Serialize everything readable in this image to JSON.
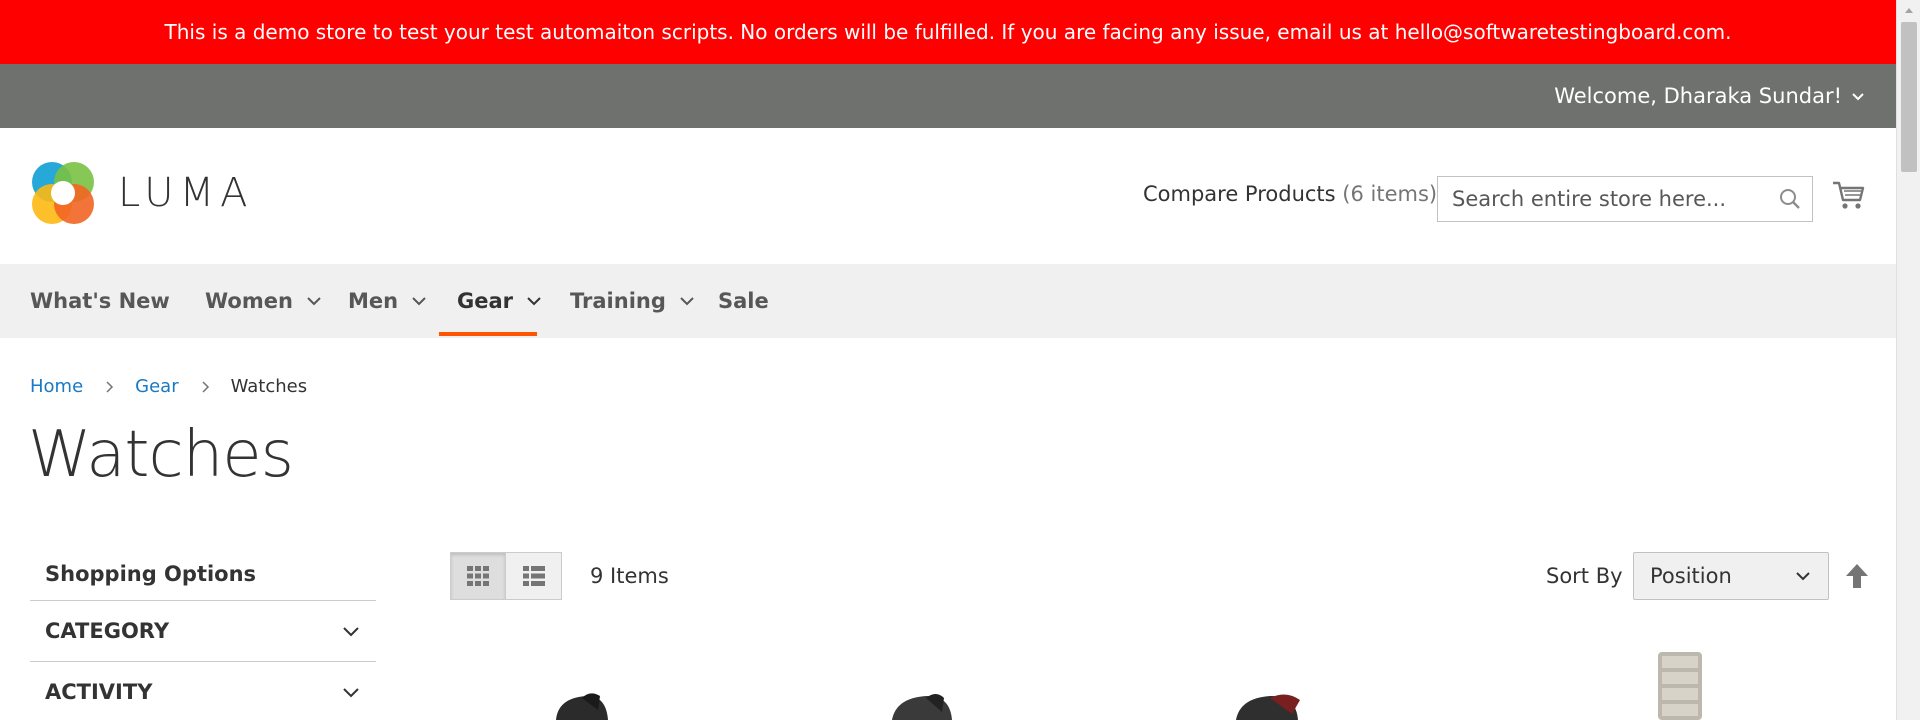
{
  "banner": {
    "text": "This is a demo store to test your test automaiton scripts. No orders will be fulfilled. If you are facing any issue, email us at hello@softwaretestingboard.com."
  },
  "top_bar": {
    "welcome": "Welcome, Dharaka Sundar!"
  },
  "header": {
    "logo_text": "LUMA",
    "compare_label": "Compare Products",
    "compare_count": "(6 items)",
    "search_placeholder": "Search entire store here..."
  },
  "nav": {
    "items": [
      {
        "label": "What's New"
      },
      {
        "label": "Women"
      },
      {
        "label": "Men"
      },
      {
        "label": "Gear",
        "active": true
      },
      {
        "label": "Training"
      },
      {
        "label": "Sale"
      }
    ]
  },
  "breadcrumb": {
    "home": "Home",
    "gear": "Gear",
    "current": "Watches"
  },
  "page": {
    "title": "Watches"
  },
  "sidebar": {
    "heading": "Shopping Options",
    "filters": [
      "CATEGORY",
      "ACTIVITY"
    ]
  },
  "toolbar": {
    "amount": "9 Items",
    "sort_label": "Sort By",
    "sort_value": "Position"
  },
  "colors": {
    "banner": "#ff0000",
    "top_bar": "#6e716e",
    "nav_bg": "#f0f0f0",
    "nav_active_underline": "#ff5501",
    "link": "#1979c3"
  }
}
